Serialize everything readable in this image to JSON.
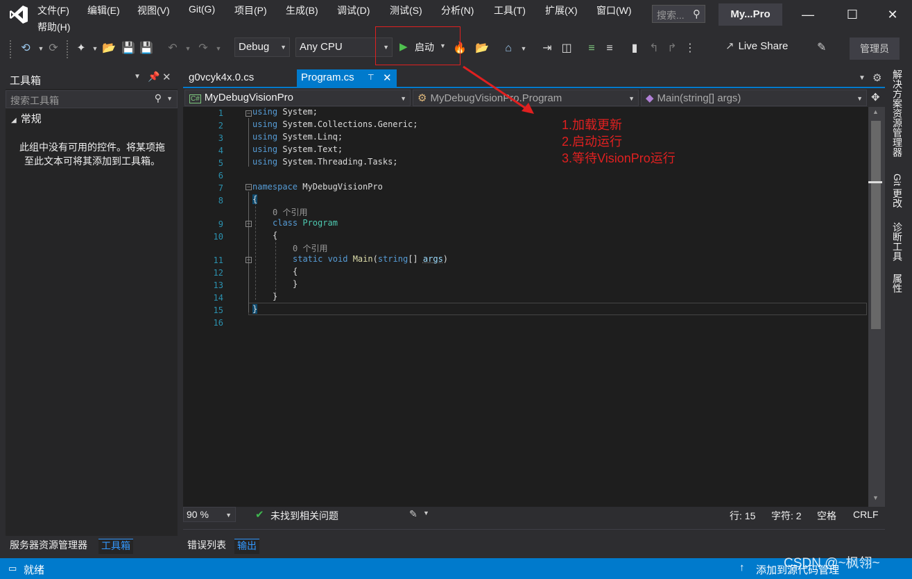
{
  "menu": {
    "items": [
      "文件(F)",
      "编辑(E)",
      "视图(V)",
      "Git(G)",
      "项目(P)",
      "生成(B)",
      "调试(D)",
      "测试(S)",
      "分析(N)",
      "工具(T)",
      "扩展(X)",
      "窗口(W)"
    ],
    "help": "帮助(H)",
    "search_placeholder": "搜索...",
    "solution_title": "My...Pro"
  },
  "toolbar": {
    "config": "Debug",
    "platform": "Any CPU",
    "start_label": "启动",
    "liveshare_label": "Live Share",
    "admin_label": "管理员"
  },
  "toolbox": {
    "title": "工具箱",
    "search_placeholder": "搜索工具箱",
    "group": "常规",
    "empty_text": "此组中没有可用的控件。将某项拖至此文本可将其添加到工具箱。",
    "bottom_tabs": [
      "服务器资源管理器",
      "工具箱"
    ]
  },
  "editor": {
    "tabs": [
      "g0vcyk4x.0.cs",
      "Program.cs"
    ],
    "nav_project": "MyDebugVisionPro",
    "nav_class": "MyDebugVisionPro.Program",
    "nav_member": "Main(string[] args)",
    "line_numbers": [
      "1",
      "2",
      "3",
      "4",
      "5",
      "6",
      "7",
      "8",
      "9",
      "10",
      "11",
      "12",
      "13",
      "14",
      "15",
      "16"
    ],
    "codelens": "0 个引用",
    "lines": {
      "l1": [
        "using",
        " System;"
      ],
      "l2": [
        "using",
        " System.Collections.Generic;"
      ],
      "l3": [
        "using",
        " System.Linq;"
      ],
      "l4": [
        "using",
        " System.Text;"
      ],
      "l5": [
        "using",
        " System.Threading.Tasks;"
      ],
      "l7_kw": "namespace",
      "l7_name": " MyDebugVisionPro",
      "l8": "{",
      "l9_kw": "class",
      "l9_name": " Program",
      "l10": "{",
      "l11_static": "static",
      "l11_void": " void",
      "l11_main": " Main",
      "l11_open": "(",
      "l11_string": "string",
      "l11_arr": "[] ",
      "l11_args": "args",
      "l11_close": ")",
      "l12": "{",
      "l13": "}",
      "l14": "}",
      "l15": "}"
    }
  },
  "annotation": {
    "lines": [
      "1.加载更新",
      "2.启动运行",
      "3.等待VisionPro运行"
    ],
    "color": "#e02020"
  },
  "editor_status": {
    "zoom": "90 %",
    "issues": "未找到相关问题",
    "line": "行: 15",
    "char": "字符: 2",
    "whitespace": "空格",
    "eol": "CRLF"
  },
  "output_tabs": [
    "错误列表",
    "输出"
  ],
  "right_dock": [
    "解决方案资源管理器",
    "Git 更改",
    "诊断工具",
    "属性"
  ],
  "statusbar": {
    "ready": "就绪",
    "source_control": "添加到源代码管理",
    "watermark": "CSDN @~枫翎~",
    "accent": "#007acc"
  }
}
